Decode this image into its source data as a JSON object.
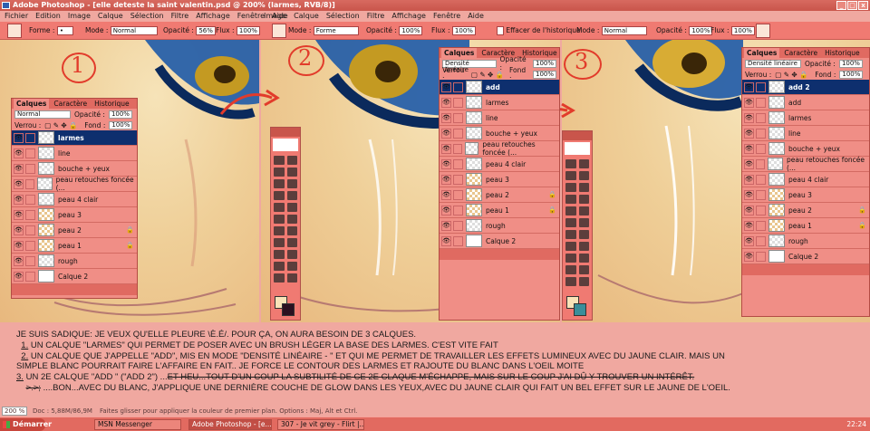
{
  "window": {
    "title": "Adobe Photoshop - [elle deteste la saint valentin.psd @ 200% (larmes, RVB/8)]",
    "controls": [
      "_",
      "□",
      "x"
    ]
  },
  "menu_left": [
    "Fichier",
    "Edition",
    "Image",
    "Calque",
    "Sélection",
    "Filtre",
    "Affichage",
    "Fenêtre",
    "Aide"
  ],
  "menu_mid": [
    "Image",
    "Calque",
    "Sélection",
    "Filtre",
    "Affichage",
    "Fenêtre",
    "Aide"
  ],
  "options": {
    "p1": {
      "forme_label": "Forme :",
      "mode_label": "Mode :",
      "mode_value": "Normal",
      "opacity_label": "Opacité :",
      "opacity_value": "56%",
      "flux_label": "Flux :",
      "flux_value": "100%"
    },
    "p2": {
      "mode_label": "Mode :",
      "mode_value": "Forme",
      "opacity_label": "Opacité :",
      "opacity_value": "100%",
      "flux_label": "Flux :",
      "flux_value": "100%",
      "history_label": "Effacer de l'historique"
    },
    "p3": {
      "mode_label": "Mode :",
      "mode_value": "Normal",
      "opacity_label": "Opacité :",
      "opacity_value": "100%",
      "flux_label": "Flux :",
      "flux_value": "100%"
    }
  },
  "steps": [
    "1",
    "2",
    "3"
  ],
  "panels": [
    {
      "tabs": [
        "Calques",
        "Caractère",
        "Historique"
      ],
      "blend": "Normal",
      "opacity_label": "Opacité :",
      "opacity": "100%",
      "lock_label": "Verrou :",
      "fill_label": "Fond :",
      "fill": "100%",
      "layers": [
        {
          "name": "larmes",
          "active": true,
          "thumb": "checker",
          "lock": false
        },
        {
          "name": "line",
          "active": false,
          "thumb": "checker",
          "lock": false
        },
        {
          "name": "bouche + yeux",
          "active": false,
          "thumb": "checker",
          "lock": false
        },
        {
          "name": "peau retouches foncée (...",
          "active": false,
          "thumb": "checker",
          "lock": false
        },
        {
          "name": "peau 4  clair",
          "active": false,
          "thumb": "checker",
          "lock": false
        },
        {
          "name": "peau 3",
          "active": false,
          "thumb": "tan",
          "lock": false
        },
        {
          "name": "peau 2",
          "active": false,
          "thumb": "tan",
          "lock": true
        },
        {
          "name": "peau 1",
          "active": false,
          "thumb": "tan",
          "lock": true
        },
        {
          "name": "rough",
          "active": false,
          "thumb": "checker",
          "lock": false
        },
        {
          "name": "Calque 2",
          "active": false,
          "thumb": "white",
          "lock": false
        }
      ]
    },
    {
      "tabs": [
        "Calques",
        "Caractère",
        "Historique"
      ],
      "blend": "Densité linéaire",
      "opacity_label": "Opacité :",
      "opacity": "100%",
      "lock_label": "Verrou :",
      "fill_label": "Fond :",
      "fill": "100%",
      "layers": [
        {
          "name": "add",
          "active": true,
          "thumb": "checker",
          "lock": false
        },
        {
          "name": "larmes",
          "active": false,
          "thumb": "checker",
          "lock": false
        },
        {
          "name": "line",
          "active": false,
          "thumb": "checker",
          "lock": false
        },
        {
          "name": "bouche + yeux",
          "active": false,
          "thumb": "checker",
          "lock": false
        },
        {
          "name": "peau retouches foncée (...",
          "active": false,
          "thumb": "checker",
          "lock": false
        },
        {
          "name": "peau 4  clair",
          "active": false,
          "thumb": "checker",
          "lock": false
        },
        {
          "name": "peau 3",
          "active": false,
          "thumb": "tan",
          "lock": false
        },
        {
          "name": "peau 2",
          "active": false,
          "thumb": "tan",
          "lock": true
        },
        {
          "name": "peau 1",
          "active": false,
          "thumb": "tan",
          "lock": true
        },
        {
          "name": "rough",
          "active": false,
          "thumb": "checker",
          "lock": false
        },
        {
          "name": "Calque 2",
          "active": false,
          "thumb": "white",
          "lock": false
        }
      ]
    },
    {
      "tabs": [
        "Calques",
        "Caractère",
        "Historique"
      ],
      "blend": "Densité linéaire",
      "opacity_label": "Opacité :",
      "opacity": "100%",
      "lock_label": "Verrou :",
      "fill_label": "Fond :",
      "fill": "100%",
      "layers": [
        {
          "name": "add 2",
          "active": true,
          "thumb": "checker",
          "lock": false
        },
        {
          "name": "add",
          "active": false,
          "thumb": "checker",
          "lock": false
        },
        {
          "name": "larmes",
          "active": false,
          "thumb": "checker",
          "lock": false
        },
        {
          "name": "line",
          "active": false,
          "thumb": "checker",
          "lock": false
        },
        {
          "name": "bouche + yeux",
          "active": false,
          "thumb": "checker",
          "lock": false
        },
        {
          "name": "peau retouches foncée (...",
          "active": false,
          "thumb": "checker",
          "lock": false
        },
        {
          "name": "peau 4  clair",
          "active": false,
          "thumb": "checker",
          "lock": false
        },
        {
          "name": "peau 3",
          "active": false,
          "thumb": "tan",
          "lock": false
        },
        {
          "name": "peau 2",
          "active": false,
          "thumb": "tan",
          "lock": true
        },
        {
          "name": "peau 1",
          "active": false,
          "thumb": "tan",
          "lock": true
        },
        {
          "name": "rough",
          "active": false,
          "thumb": "checker",
          "lock": false
        },
        {
          "name": "Calque 2",
          "active": false,
          "thumb": "white",
          "lock": false
        }
      ]
    }
  ],
  "caption": {
    "line1": "JE SUIS SADIQUE: JE VEUX QU'ELLE PLEURE \\è.é/. POUR ÇA, ON AURA BESOIN DE 3 CALQUES.",
    "line2_num": "1.",
    "line2": " UN CALQUE \"LARMES\" QUI PERMET DE POSER AVEC UN BRUSH LÉGER LA BASE DES LARMES. C'EST VITE FAIT",
    "line3_num": "2.",
    "line3": " UN CALQUE QUE J'APPELLE \"ADD\", MIS EN MODE \"DENSITÉ LINÉAIRE - \" ET QUI ME PERMET DE TRAVAILLER LES EFFETS LUMINEUX AVEC DU JAUNE CLAIR. MAIS UN",
    "line4": "SIMPLE BLANC POURRAIT FAIRE L'AFFAIRE EN FAIT.. JE FORCE LE CONTOUR DES LARMES ET RAJOUTE DU BLANC DANS L'OEIL MOITE",
    "line5_num": "3.",
    "line5_a": " UN 2E CALQUE \"ADD \" (\"ADD 2\")  ...",
    "line5_strike": "ET HEU...TOUT D'UN COUP LA SUBTILITÉ DE CE 2E CLAQUE M'ÉCHAPPE, MAIS SUR LE COUP J'AI DÛ Y TROUVER UN INTÉRÊT.",
    "line6_strike": ">.>;",
    "line6": "  ....BON...AVEC DU BLANC, J'APPLIQUE UNE DERNIÈRE COUCHE DE GLOW DANS LES YEUX,AVEC DU JAUNE CLAIR QUI FAIT UN BEL EFFET SUR LE JAUNE DE L'OEIL."
  },
  "status": {
    "zoom": "200 %",
    "doc": "Doc : 5,88M/86,9M",
    "hint": "Faites glisser pour appliquer la couleur de premier plan. Options : Maj, Alt et Ctrl."
  },
  "taskbar": {
    "start": "Démarrer",
    "tasks": [
      "MSN Messenger",
      "Adobe Photoshop - [e...",
      "307 - Je vit grey - Flirt |..."
    ],
    "clock": "22:24"
  },
  "colors": {
    "tint": "#f0a8a0",
    "active_layer": "#0e2f6e",
    "accent_red": "#e23b2b"
  }
}
